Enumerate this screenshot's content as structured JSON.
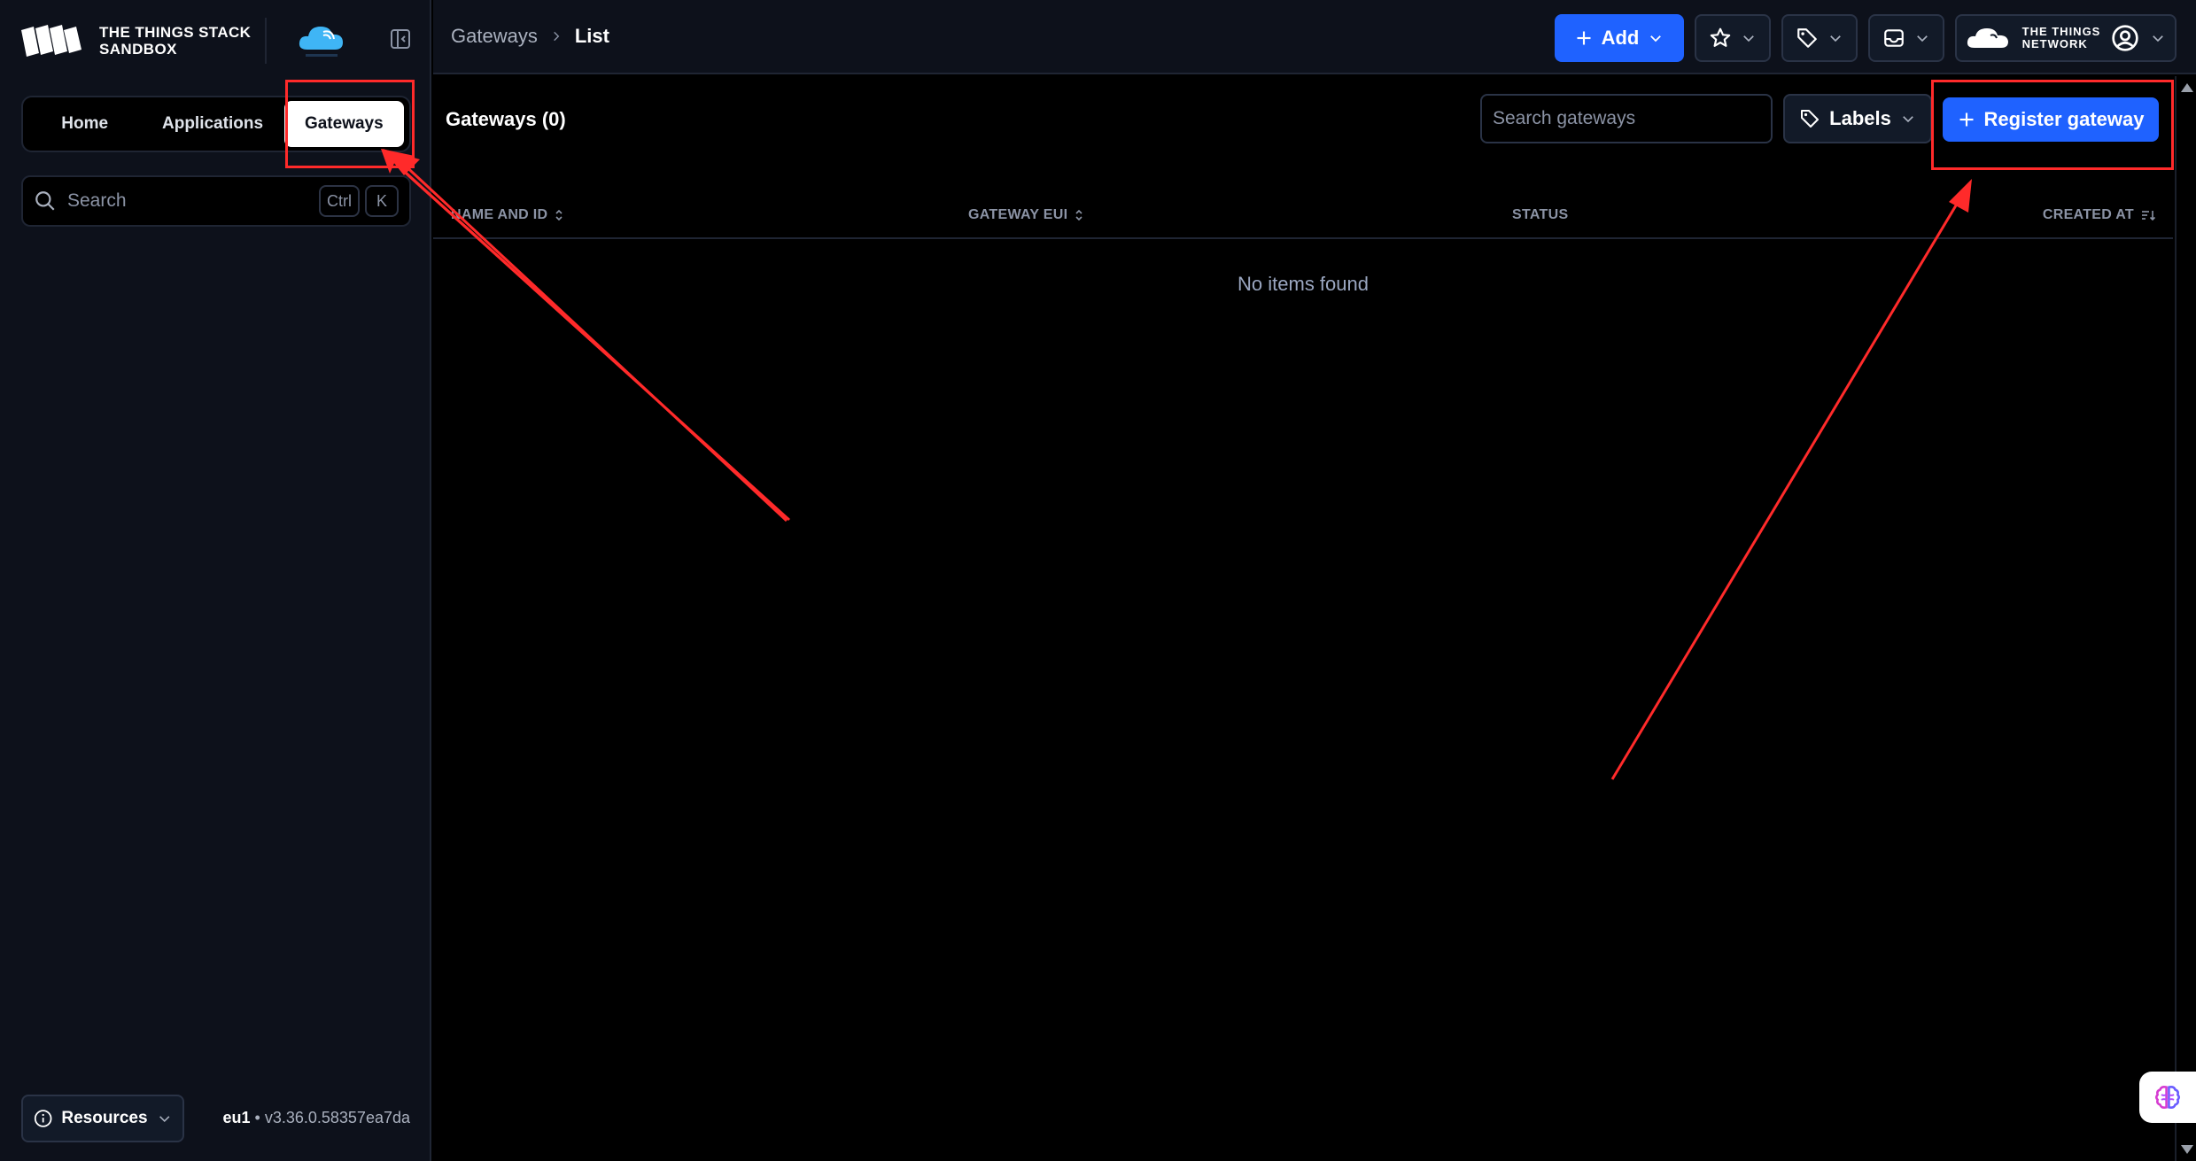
{
  "brand": {
    "line1": "THE THINGS STACK",
    "line2": "SANDBOX"
  },
  "sidebar": {
    "tabs": [
      {
        "label": "Home"
      },
      {
        "label": "Applications"
      },
      {
        "label": "Gateways",
        "active": true
      }
    ],
    "search": {
      "placeholder": "Search",
      "shortcut_mod": "Ctrl",
      "shortcut_key": "K"
    },
    "resources_label": "Resources",
    "version": {
      "cluster": "eu1",
      "separator": "•",
      "build": "v3.36.0.58357ea7da"
    }
  },
  "topbar": {
    "breadcrumb": [
      "Gateways",
      "List"
    ],
    "add_label": "Add",
    "profile": {
      "line1": "THE THINGS",
      "line2": "NETWORK"
    }
  },
  "main": {
    "title": "Gateways (0)",
    "search_placeholder": "Search gateways",
    "labels_label": "Labels",
    "register_label": "Register gateway",
    "columns": [
      "NAME AND ID",
      "GATEWAY EUI",
      "STATUS",
      "CREATED AT"
    ],
    "empty_text": "No items found"
  },
  "colors": {
    "primary": "#1f62ff",
    "annotation": "#ff2a2a",
    "sidebar_bg": "#0d111b"
  }
}
